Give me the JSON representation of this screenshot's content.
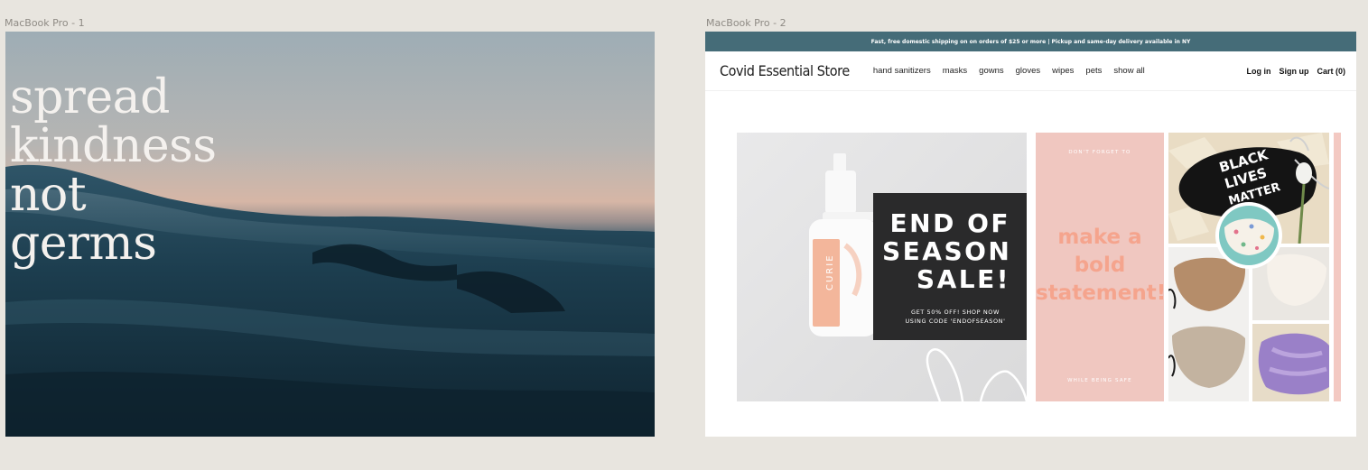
{
  "frames": {
    "frame1_label": "MacBook Pro - 1",
    "frame2_label": "MacBook Pro - 2"
  },
  "hero": {
    "lines": [
      "spread",
      "kindness",
      "not",
      "germs"
    ]
  },
  "store": {
    "promo": "Fast, free domestic shipping on on orders of $25 or more | Pickup and same-day delivery available in NY",
    "name": "Covid Essential Store",
    "nav": [
      "hand sanitizers",
      "masks",
      "gowns",
      "gloves",
      "wipes",
      "pets",
      "show all"
    ],
    "account": {
      "login": "Log in",
      "signup": "Sign up",
      "cart": "Cart (0)"
    }
  },
  "banners": {
    "sale": {
      "product_brand": "CURIE",
      "title_lines": [
        "END OF",
        "SEASON",
        "SALE!"
      ],
      "sub_lines": [
        "GET 50% OFF! SHOP NOW",
        "USING CODE 'ENDOFSEASON'"
      ]
    },
    "bold": {
      "top": "DON'T FORGET TO",
      "lines": [
        "make a",
        "bold",
        "statement!"
      ],
      "bottom": "WHILE BEING SAFE"
    },
    "masks": {
      "mask_text_lines": [
        "BLACK",
        "LIVES",
        "MATTER"
      ]
    }
  },
  "colors": {
    "promo_bar": "#456c78",
    "bold_bg": "#f0c7c0",
    "bold_text": "#f5a48d",
    "sale_box": "#2a2a2b"
  }
}
